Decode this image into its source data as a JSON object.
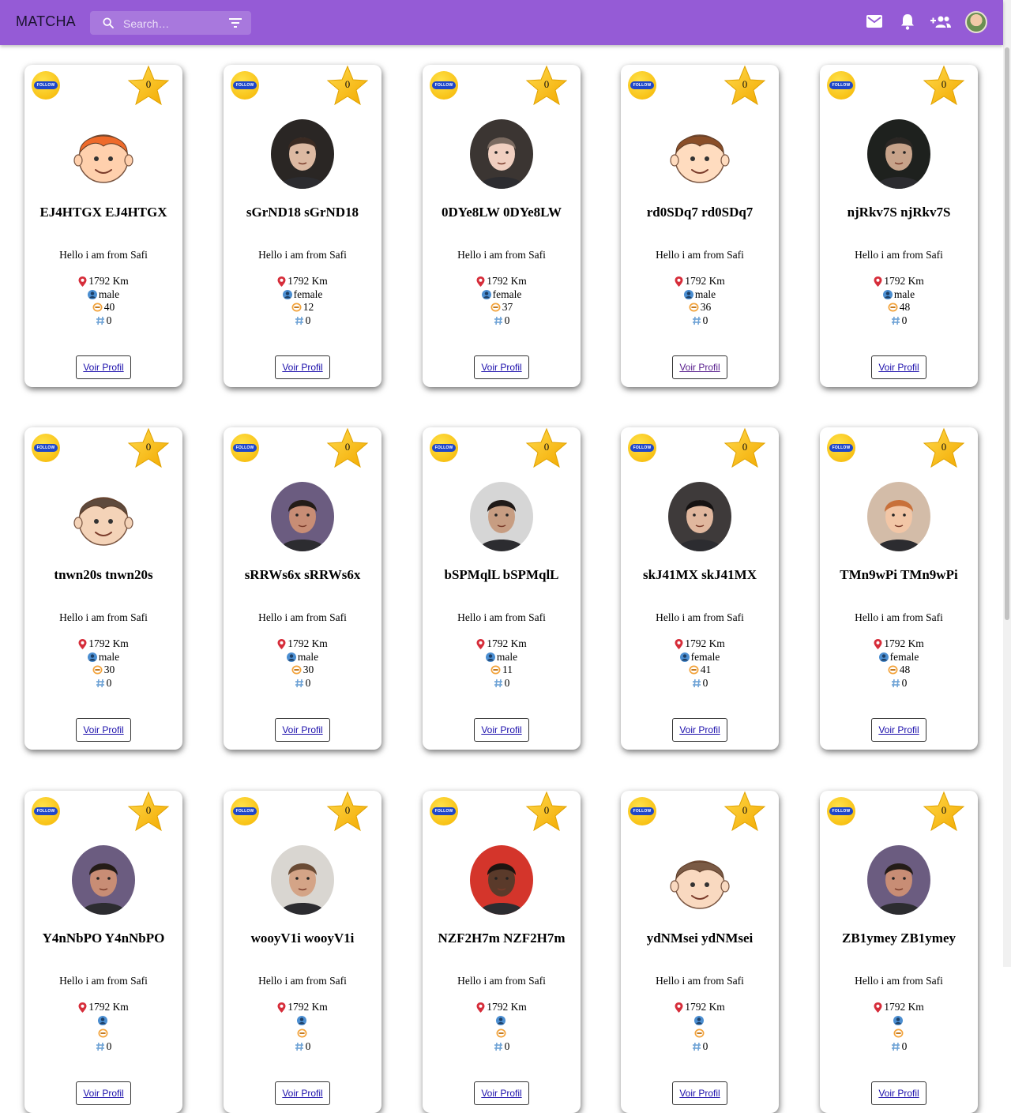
{
  "app": {
    "title": "MATCHA"
  },
  "search": {
    "placeholder": "Search…"
  },
  "icons": {
    "search": "search-icon",
    "filter": "filter-icon",
    "mail": "mail-icon",
    "bell": "notifications-icon",
    "people": "group-add-icon",
    "location": "location-pin-icon",
    "gender": "person-icon",
    "age": "age-badge-icon",
    "tags": "hashtag-icon"
  },
  "colors": {
    "appbar": "#955bd6",
    "follow": "#f5b400",
    "star": "#f7c21a",
    "link": "#1a0dab"
  },
  "card_common": {
    "follow_label": "FOLLOW",
    "star_count": "0",
    "bio": "Hello i am from Safi",
    "distance": "1792 Km",
    "tags": "0",
    "button_label": "Voir Profil"
  },
  "cards": [
    {
      "name": "EJ4HTGX EJ4HTGX",
      "gender": "male",
      "age": "40"
    },
    {
      "name": "sGrND18 sGrND18",
      "gender": "female",
      "age": "12"
    },
    {
      "name": "0DYe8LW 0DYe8LW",
      "gender": "female",
      "age": "37"
    },
    {
      "name": "rd0SDq7 rd0SDq7",
      "gender": "male",
      "age": "36"
    },
    {
      "name": "njRkv7S njRkv7S",
      "gender": "male",
      "age": "48"
    },
    {
      "name": "tnwn20s tnwn20s",
      "gender": "male",
      "age": "30"
    },
    {
      "name": "sRRWs6x sRRWs6x",
      "gender": "male",
      "age": "30"
    },
    {
      "name": "bSPMqlL bSPMqlL",
      "gender": "male",
      "age": "11"
    },
    {
      "name": "skJ41MX skJ41MX",
      "gender": "female",
      "age": "41"
    },
    {
      "name": "TMn9wPi TMn9wPi",
      "gender": "female",
      "age": "48"
    },
    {
      "name": "Y4nNbPO Y4nNbPO",
      "gender": "",
      "age": ""
    },
    {
      "name": "wooyV1i wooyV1i",
      "gender": "",
      "age": ""
    },
    {
      "name": "NZF2H7m NZF2H7m",
      "gender": "",
      "age": ""
    },
    {
      "name": "ydNMsei ydNMsei",
      "gender": "",
      "age": ""
    },
    {
      "name": "ZB1ymey ZB1ymey",
      "gender": "",
      "age": ""
    }
  ]
}
